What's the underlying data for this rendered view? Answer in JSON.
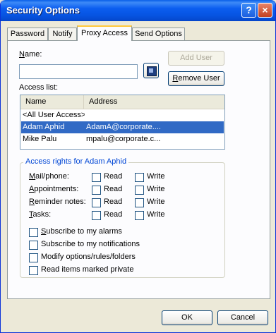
{
  "window": {
    "title": "Security Options",
    "help_glyph": "?",
    "close_glyph": "×"
  },
  "tabs": [
    {
      "label": "Password",
      "active": false
    },
    {
      "label": "Notify",
      "active": false
    },
    {
      "label": "Proxy Access",
      "active": true
    },
    {
      "label": "Send Options",
      "active": false
    }
  ],
  "name_label": {
    "accel": "N",
    "rest": "ame:"
  },
  "name_value": "",
  "add_user_label": "Add User",
  "remove_user_label": {
    "accel": "R",
    "rest": "emove User"
  },
  "access_list_label": "Access list:",
  "columns": [
    "Name",
    "Address"
  ],
  "rows": [
    {
      "name": "<All User Access>",
      "address": ""
    },
    {
      "name": "Adam Aphid",
      "address": "AdamA@corporate...."
    },
    {
      "name": "Mike Palu",
      "address": "mpalu@corporate.c..."
    }
  ],
  "rights_title": "Access rights for Adam Aphid",
  "rights": [
    {
      "accel": "M",
      "rest": "ail/phone:"
    },
    {
      "accel": "A",
      "rest": "ppointments:"
    },
    {
      "accel": "R",
      "rest": "eminder notes:"
    },
    {
      "accel": "T",
      "rest": "asks:"
    }
  ],
  "read_label": "Read",
  "write_label": "Write",
  "options": [
    {
      "accel": "S",
      "rest": "ubscribe to my alarms"
    },
    {
      "accel": "",
      "rest": "Subscribe to my notifications"
    },
    {
      "accel": "",
      "rest": "Modify options/rules/folders"
    },
    {
      "accel": "",
      "rest": "Read items marked private"
    }
  ],
  "ok_label": "OK",
  "cancel_label": "Cancel"
}
